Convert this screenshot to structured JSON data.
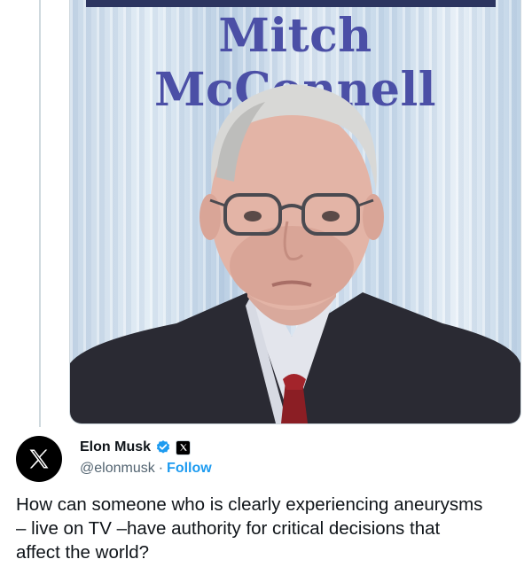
{
  "media": {
    "title": "Mitch McConnell"
  },
  "author": {
    "name": "Elon Musk",
    "handle": "@elonmusk",
    "separator": "·",
    "follow_label": "Follow",
    "verified_color": "#1d9bf0",
    "avatar_icon": "x-logo-icon"
  },
  "tweet": {
    "line1": "How can someone who is clearly experiencing aneurysms",
    "line2": "– live on TV –have authority for critical decisions that",
    "line3": "affect the world?"
  },
  "colors": {
    "accent": "#1d9bf0",
    "text": "#0f1419",
    "muted": "#536471",
    "title": "#4b4fa6"
  }
}
